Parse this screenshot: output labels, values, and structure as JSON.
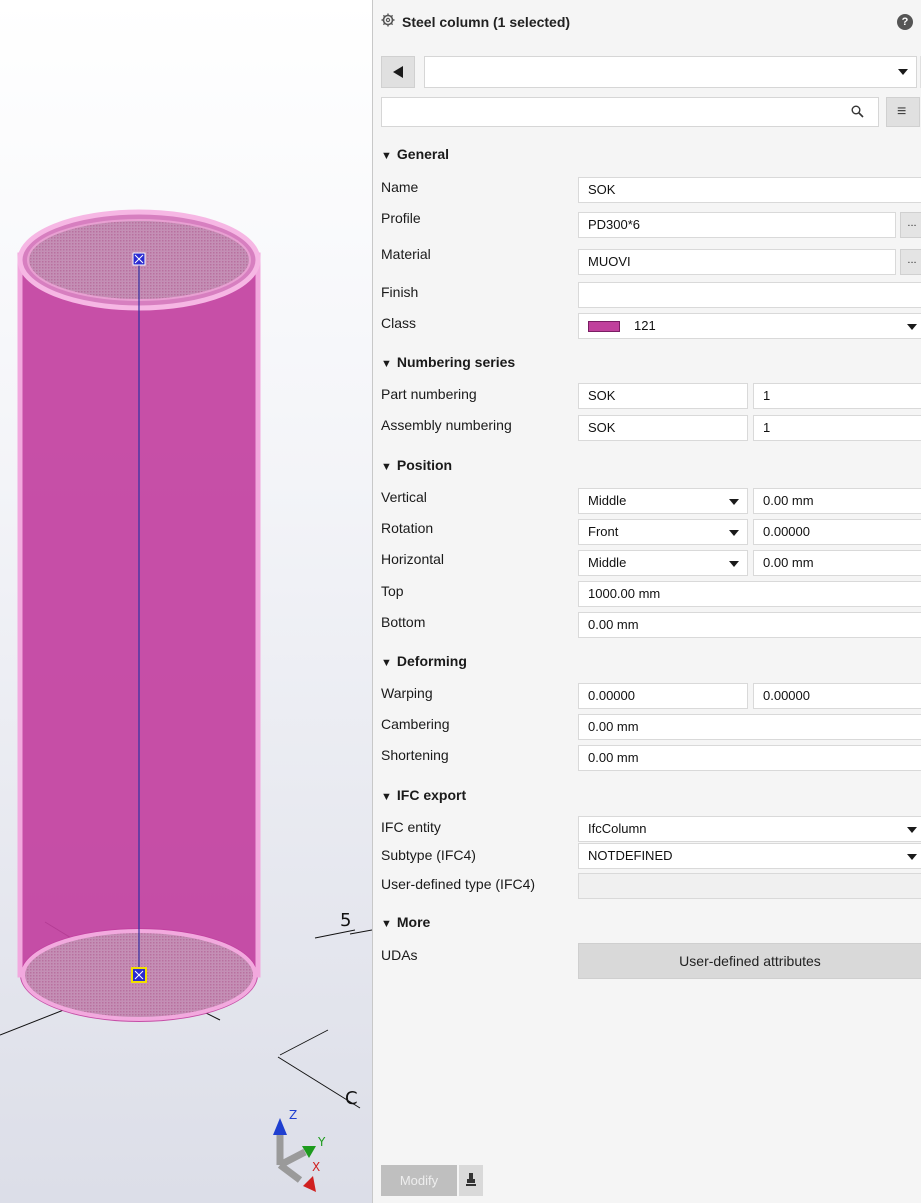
{
  "viewport": {
    "grid_labels": [
      "5",
      "C"
    ],
    "axes": [
      "Z",
      "Y",
      "X"
    ],
    "part_color": "#c2409f"
  },
  "panel": {
    "title": "Steel column (1 selected)",
    "title_icon": "gear-icon",
    "help_label": "?",
    "close_label": "✕",
    "preset_value": "",
    "search_placeholder": "",
    "menu_label": "≡",
    "sections": {
      "general": "General",
      "numbering": "Numbering series",
      "position": "Position",
      "deforming": "Deforming",
      "ifc": "IFC export",
      "more": "More"
    },
    "general": {
      "name_label": "Name",
      "name_value": "SOK",
      "profile_label": "Profile",
      "profile_value": "PD300*6",
      "material_label": "Material",
      "material_value": "MUOVI",
      "finish_label": "Finish",
      "finish_value": "",
      "class_label": "Class",
      "class_value": "121",
      "class_color": "#c0409c",
      "browse_label": "..."
    },
    "numbering": {
      "part_label": "Part numbering",
      "part_prefix": "SOK",
      "part_start": "1",
      "assembly_label": "Assembly numbering",
      "assembly_prefix": "SOK",
      "assembly_start": "1"
    },
    "position": {
      "vertical_label": "Vertical",
      "vertical_option": "Middle",
      "vertical_offset": "0.00 mm",
      "rotation_label": "Rotation",
      "rotation_option": "Front",
      "rotation_offset": "0.00000",
      "horizontal_label": "Horizontal",
      "horizontal_option": "Middle",
      "horizontal_offset": "0.00 mm",
      "top_label": "Top",
      "top_value": "1000.00 mm",
      "bottom_label": "Bottom",
      "bottom_value": "0.00 mm"
    },
    "deforming": {
      "warping_label": "Warping",
      "warping_start": "0.00000",
      "warping_end": "0.00000",
      "cambering_label": "Cambering",
      "cambering_value": "0.00 mm",
      "shortening_label": "Shortening",
      "shortening_value": "0.00 mm"
    },
    "ifc": {
      "entity_label": "IFC entity",
      "entity_value": "IfcColumn",
      "subtype_label": "Subtype (IFC4)",
      "subtype_value": "NOTDEFINED",
      "userdef_label": "User-defined type (IFC4)",
      "userdef_value": ""
    },
    "more": {
      "udas_label": "UDAs",
      "uda_button": "User-defined attributes"
    },
    "footer": {
      "modify_label": "Modify",
      "pick_icon": "pick-icon"
    }
  }
}
